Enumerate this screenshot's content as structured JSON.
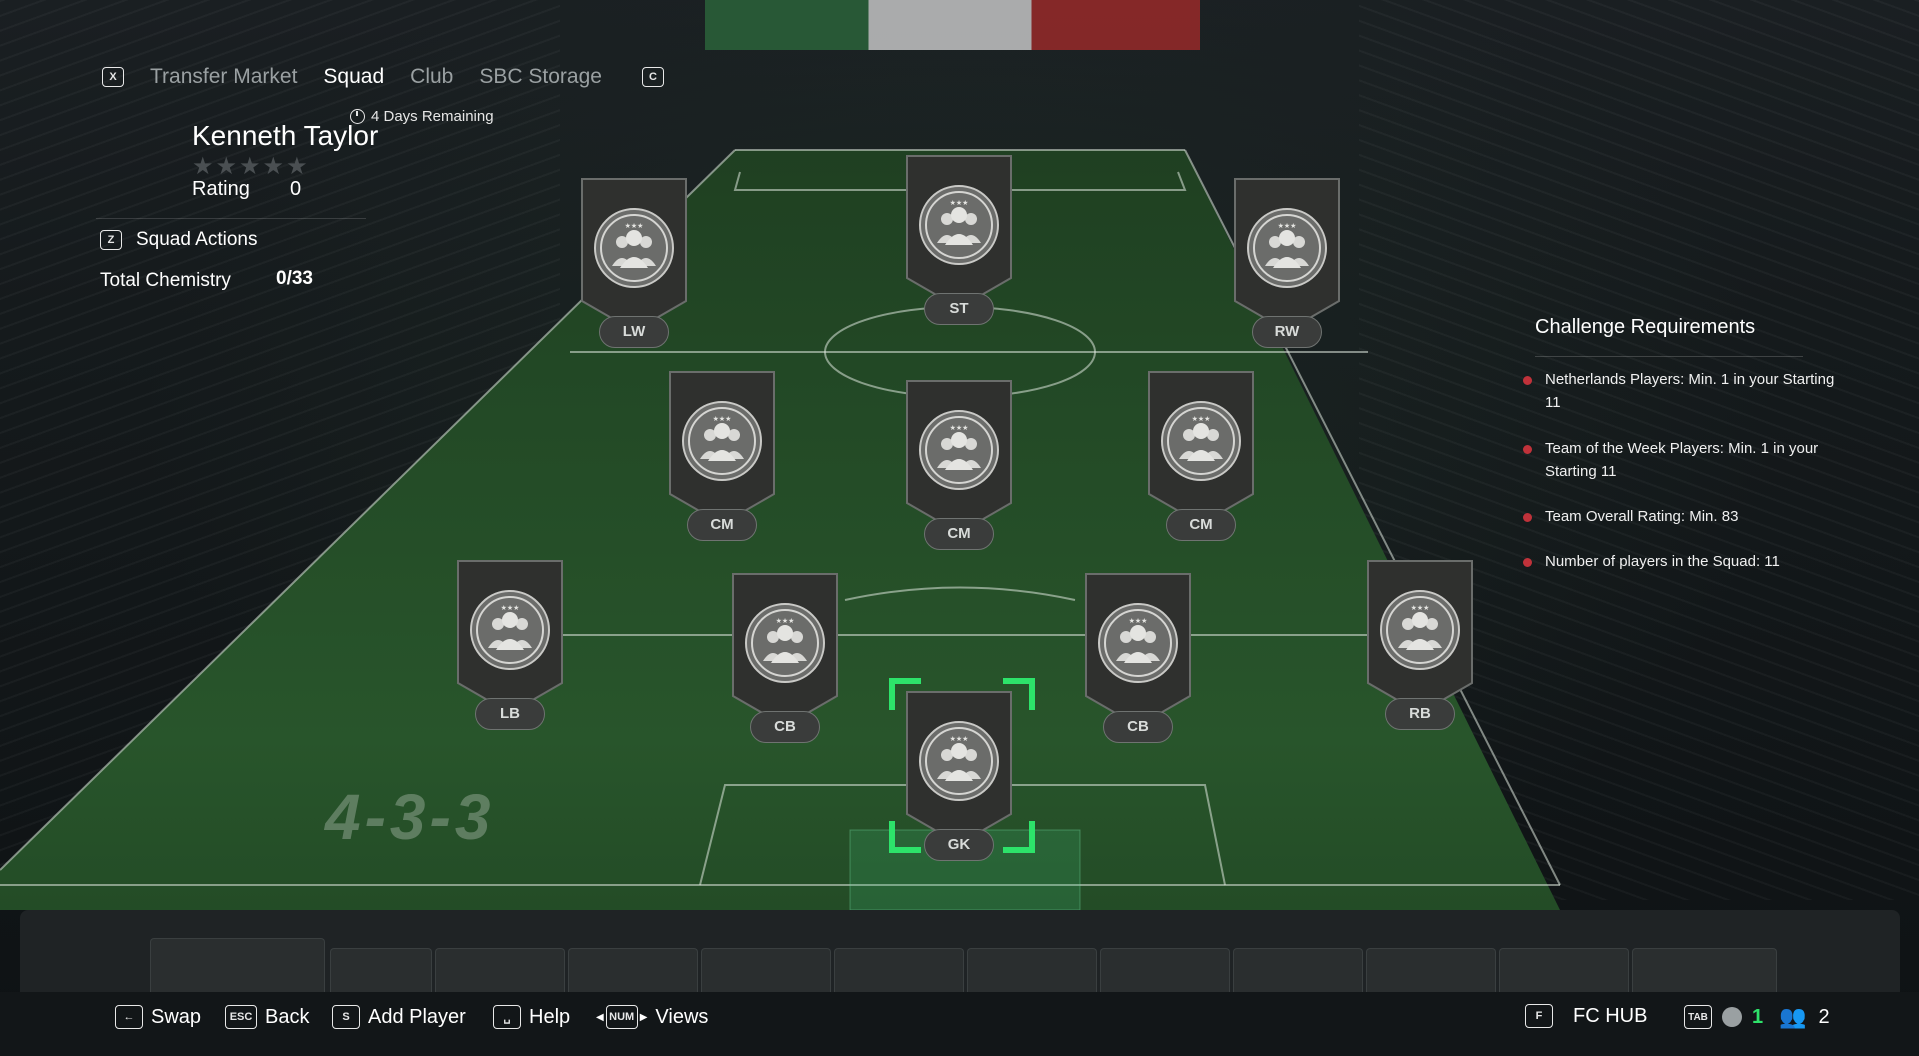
{
  "nav": {
    "left_key": "X",
    "tabs": [
      {
        "label": "Transfer Market",
        "active": false
      },
      {
        "label": "Squad",
        "active": true
      },
      {
        "label": "Club",
        "active": false
      },
      {
        "label": "SBC Storage",
        "active": false
      }
    ],
    "right_key": "C"
  },
  "timer": {
    "label": "4 Days Remaining",
    "icon": "stopwatch-icon"
  },
  "squad": {
    "name": "Kenneth Taylor",
    "stars": "★★★★★",
    "rating_label": "Rating",
    "rating_value": "0",
    "actions_key": "Z",
    "actions_label": "Squad Actions",
    "chemistry_label": "Total Chemistry",
    "chemistry_value": "0/33"
  },
  "formation": "4-3-3",
  "positions": [
    {
      "id": "lw",
      "label": "LW"
    },
    {
      "id": "st",
      "label": "ST"
    },
    {
      "id": "rw",
      "label": "RW"
    },
    {
      "id": "cm1",
      "label": "CM"
    },
    {
      "id": "cm2",
      "label": "CM"
    },
    {
      "id": "cm3",
      "label": "CM"
    },
    {
      "id": "lb",
      "label": "LB"
    },
    {
      "id": "cb1",
      "label": "CB"
    },
    {
      "id": "cb2",
      "label": "CB"
    },
    {
      "id": "rb",
      "label": "RB"
    },
    {
      "id": "gk",
      "label": "GK",
      "selected": true
    }
  ],
  "requirements": {
    "title": "Challenge Requirements",
    "items": [
      "Netherlands Players: Min. 1 in your Starting 11",
      "Team of the Week Players: Min. 1 in your Starting 11",
      "Team Overall Rating: Min. 83",
      "Number of players in the Squad: 11"
    ],
    "bullet_color": "#c0323a"
  },
  "bottom_bar": {
    "hints": [
      {
        "key": "←",
        "label": "Swap",
        "icon": "back-arrow-key-icon"
      },
      {
        "key": "ESC",
        "label": "Back"
      },
      {
        "key": "S",
        "label": "Add Player"
      },
      {
        "key": "␣",
        "label": "Help",
        "icon": "spacebar-key-icon"
      },
      {
        "key": "NUM",
        "label": "Views"
      }
    ],
    "hub_key": "F",
    "hub_label": "FC HUB",
    "tab_key": "TAB",
    "notifications_count": "1",
    "friends_count": "2"
  },
  "colors": {
    "accent_green": "#2ee26a",
    "card_fill": "#2f302e",
    "requirement_bullet": "#c0323a"
  }
}
